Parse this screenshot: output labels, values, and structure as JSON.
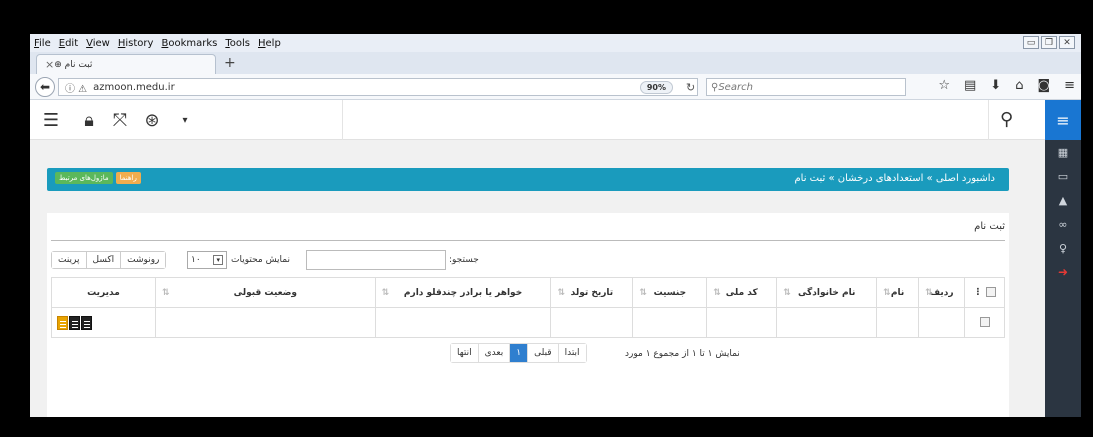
{
  "menubar": [
    "File",
    "Edit",
    "View",
    "History",
    "Bookmarks",
    "Tools",
    "Help"
  ],
  "tab": {
    "title": "ثبت نام",
    "close": "×",
    "new": "+"
  },
  "nav": {
    "url": "azmoon.medu.ir",
    "zoom": "90%",
    "search_placeholder": "Search"
  },
  "breadcrumb": "داشبورد اصلی » استعدادهای درخشان » ثبت نام",
  "help_button": "راهنما",
  "related_button": "ماژول‌های مرتبط",
  "panel_title": "ثبت نام",
  "controls": {
    "buttons": [
      "پرینت",
      "اکسل",
      "رونوشت"
    ],
    "length_label": "نمایش محتویات",
    "length_value": "۱۰",
    "search_label": "جستجو:"
  },
  "table": {
    "headers": [
      "ردیف",
      "نام",
      "نام خانوادگی",
      "کد ملی",
      "جنسیت",
      "تاریخ تولد",
      "خواهر یا برادر چندقلو دارم",
      "وضعیت قبولی",
      "مدیریت"
    ]
  },
  "pager": [
    "ابتدا",
    "قبلی",
    "۱",
    "بعدی",
    "انتها"
  ],
  "info": "نمایش ۱ تا ۱ از مجموع ۱ مورد"
}
